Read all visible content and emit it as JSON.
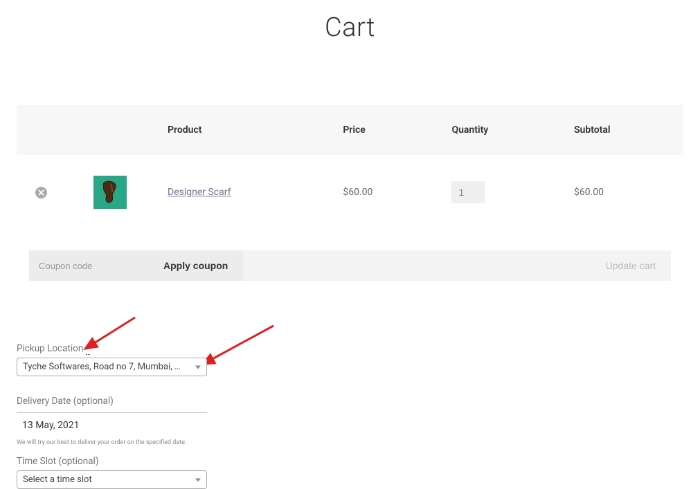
{
  "page_title": "Cart",
  "table": {
    "headers": {
      "product": "Product",
      "price": "Price",
      "quantity": "Quantity",
      "subtotal": "Subtotal"
    },
    "row": {
      "product_name": "Designer Scarf",
      "price": "$60.00",
      "quantity": "1",
      "subtotal": "$60.00"
    }
  },
  "actions": {
    "coupon_placeholder": "Coupon code",
    "apply_label": "Apply coupon",
    "update_label": "Update cart"
  },
  "form": {
    "pickup_label": "Pickup Location ",
    "required_mark": "*",
    "pickup_value": "Tyche Softwares, Road no 7, Mumbai, …",
    "date_label": "Delivery Date (optional)",
    "date_value": "13 May, 2021",
    "hint": "We will try our best to deliver your order on the specified date.",
    "timeslot_label": "Time Slot (optional)",
    "timeslot_value": "Select a time slot"
  }
}
